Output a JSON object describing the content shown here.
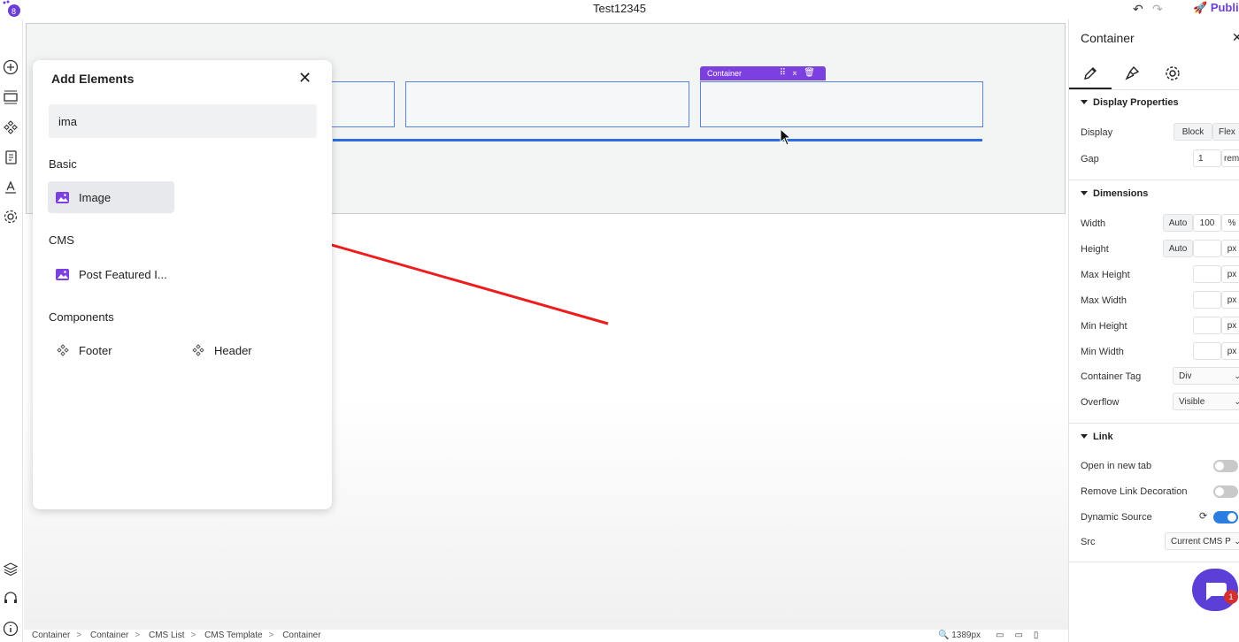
{
  "app": {
    "title": "Test12345",
    "publish_label": "Publis"
  },
  "rail_icons": [
    "add-icon",
    "section-icon",
    "components-icon",
    "pages-icon",
    "typography-icon",
    "settings-icon",
    "layers-icon",
    "support-icon",
    "info-icon"
  ],
  "canvas": {
    "container_tag_label": "Container"
  },
  "add_elements": {
    "title": "Add Elements",
    "close_label": "✕",
    "search_value": "ima",
    "basic_label": "Basic",
    "basic_items": [
      {
        "label": "Image",
        "icon": "image-icon"
      }
    ],
    "cms_label": "CMS",
    "cms_items": [
      {
        "label": "Post Featured I...",
        "icon": "image-icon"
      }
    ],
    "components_label": "Components",
    "components_items": [
      {
        "label": "Footer",
        "icon": "component-icon"
      },
      {
        "label": "Header",
        "icon": "component-icon"
      }
    ]
  },
  "right_panel": {
    "title": "Container",
    "close_label": "✕",
    "tabs": [
      "edit-icon",
      "style-icon",
      "settings-icon"
    ],
    "display_properties": {
      "heading": "Display Properties",
      "display_label": "Display",
      "display_options": [
        "Block",
        "Flex"
      ],
      "gap_label": "Gap",
      "gap_value": "1",
      "gap_unit": "rem"
    },
    "dimensions": {
      "heading": "Dimensions",
      "width_label": "Width",
      "width_mode": "Auto",
      "width_value": "100",
      "width_unit": "%",
      "height_label": "Height",
      "height_mode": "Auto",
      "height_unit": "px",
      "max_height_label": "Max Height",
      "max_height_unit": "px",
      "max_width_label": "Max Width",
      "max_width_unit": "px",
      "min_height_label": "Min Height",
      "min_height_unit": "px",
      "min_width_label": "Min Width",
      "min_width_unit": "px",
      "container_tag_label": "Container Tag",
      "container_tag_value": "Div",
      "overflow_label": "Overflow",
      "overflow_value": "Visible"
    },
    "link": {
      "heading": "Link",
      "open_new_tab_label": "Open in new tab",
      "open_new_tab_on": false,
      "remove_decoration_label": "Remove Link Decoration",
      "remove_decoration_on": false,
      "dynamic_source_label": "Dynamic Source",
      "dynamic_source_on": true,
      "src_label": "Src",
      "src_value": "Current CMS P"
    },
    "chat_badge": "1"
  },
  "bottom_bar": {
    "breadcrumb": [
      "Container",
      "Container",
      "CMS List",
      "CMS Template",
      "Container"
    ],
    "zoom": "1389px"
  },
  "colors": {
    "accent": "#7c3fe0",
    "drop_line": "#2d6ce0",
    "arrow": "#ee1c1c"
  }
}
